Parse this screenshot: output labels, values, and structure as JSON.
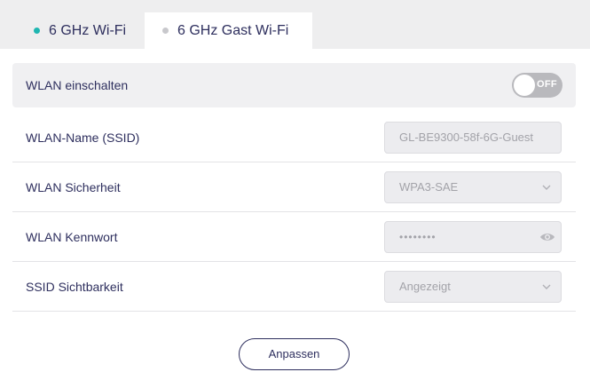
{
  "tabs": [
    {
      "label": "6 GHz Wi-Fi",
      "active": false,
      "dot_color": "#1fb6b1"
    },
    {
      "label": "6 GHz Gast Wi-Fi",
      "active": true,
      "dot_color": "#c8c8cc"
    }
  ],
  "enable": {
    "label": "WLAN einschalten",
    "toggle_text": "OFF",
    "state": "off"
  },
  "fields": {
    "ssid": {
      "label": "WLAN-Name (SSID)",
      "value": "GL-BE9300-58f-6G-Guest"
    },
    "security": {
      "label": "WLAN Sicherheit",
      "value": "WPA3-SAE"
    },
    "password": {
      "label": "WLAN Kennwort",
      "value": "••••••••"
    },
    "visibility": {
      "label": "SSID Sichtbarkeit",
      "value": "Angezeigt"
    }
  },
  "apply_button": "Anpassen",
  "colors": {
    "accent": "#1fb6b1",
    "text": "#2e2f5e",
    "toggle_off": "#b9b9bd"
  }
}
